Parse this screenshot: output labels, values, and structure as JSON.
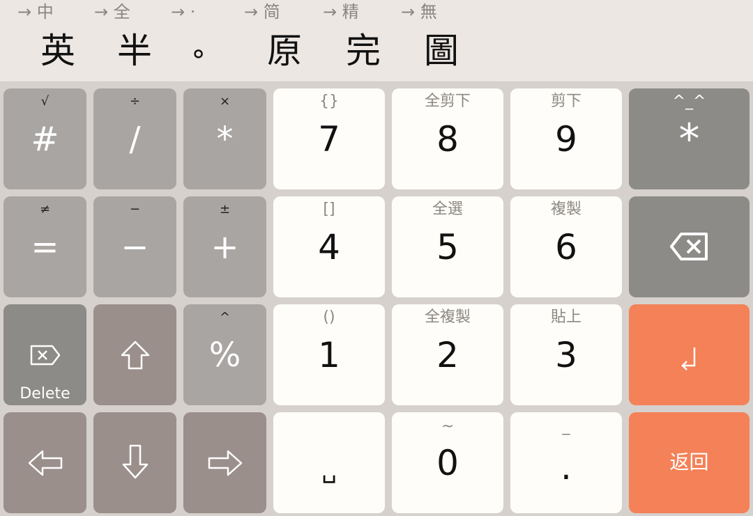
{
  "modes": [
    {
      "hint": "→ 中",
      "label": "英"
    },
    {
      "hint": "→ 全",
      "label": "半"
    },
    {
      "hint": "→ ·",
      "label": "∘"
    },
    {
      "hint": "→ 简",
      "label": "原"
    },
    {
      "hint": "→ 精",
      "label": "完"
    },
    {
      "hint": "→ 無",
      "label": "圖"
    }
  ],
  "keys": {
    "hash": {
      "sub": "√",
      "main": "#"
    },
    "slash": {
      "sub": "÷",
      "main": "/"
    },
    "star": {
      "sub": "×",
      "main": "*"
    },
    "seven": {
      "sub": "{}",
      "main": "7"
    },
    "eight": {
      "sub": "全剪下",
      "main": "8"
    },
    "nine": {
      "sub": "剪下",
      "main": "9"
    },
    "emoji": {
      "sub": "^_^",
      "main": "*"
    },
    "equals": {
      "sub": "≠",
      "main": "="
    },
    "minus": {
      "sub": "−",
      "main": "−"
    },
    "plus": {
      "sub": "±",
      "main": "+"
    },
    "four": {
      "sub": "[]",
      "main": "4"
    },
    "five": {
      "sub": "全選",
      "main": "5"
    },
    "six": {
      "sub": "複製",
      "main": "6"
    },
    "delete": {
      "label": "Delete"
    },
    "percent": {
      "sub": "^",
      "main": "%"
    },
    "one": {
      "sub": "()",
      "main": "1"
    },
    "two": {
      "sub": "全複製",
      "main": "2"
    },
    "three": {
      "sub": "貼上",
      "main": "3"
    },
    "enter": {
      "main": "↲"
    },
    "space": {
      "main": "␣"
    },
    "zero": {
      "sub": "~",
      "main": "0"
    },
    "dot": {
      "sub": "_",
      "main": "."
    },
    "back": {
      "label": "返回"
    }
  },
  "icons": {
    "backspace": "backspace-icon",
    "delete": "delete-icon",
    "shift": "shift-arrow-up-icon",
    "left": "arrow-left-icon",
    "down": "arrow-down-icon",
    "right": "arrow-right-icon",
    "enter": "enter-icon"
  },
  "colors": {
    "grey_key": "#a8a5a3",
    "brown_key": "#9a8f8b",
    "dark_key": "#8c8b88",
    "white_key": "#fefdf9",
    "accent": "#f48157",
    "toolbar": "#ece7e3",
    "keyboard_bg": "#d6d1cd"
  }
}
